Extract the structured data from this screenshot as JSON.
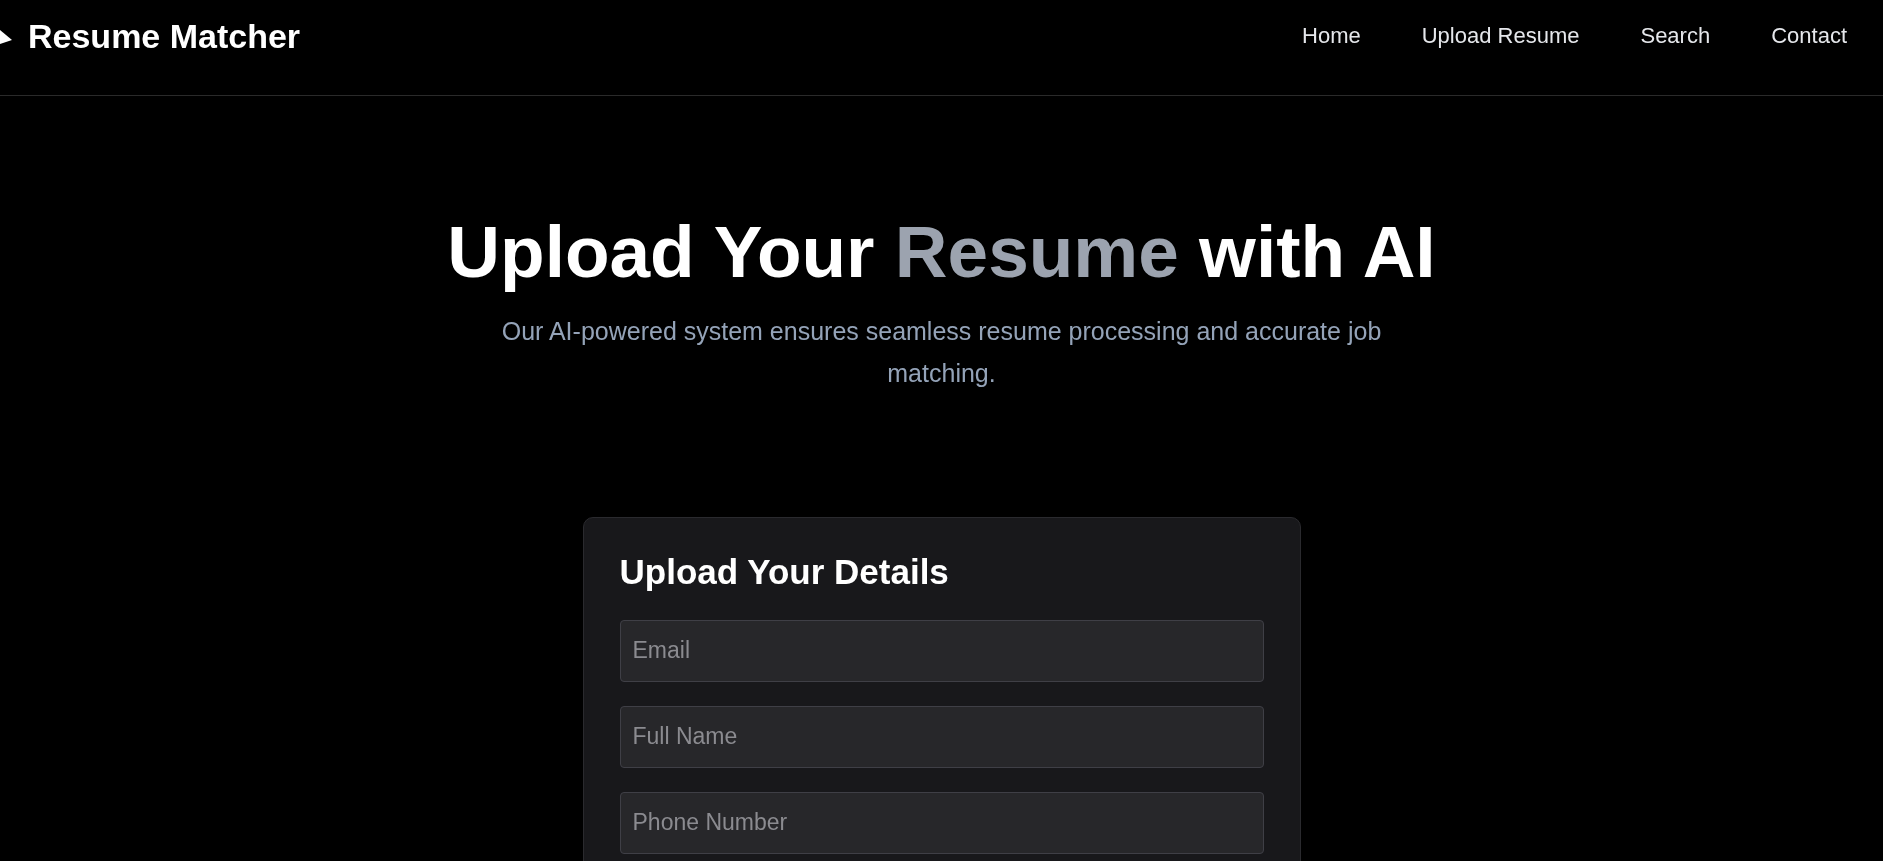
{
  "brand": {
    "name": "Resume Matcher"
  },
  "nav": [
    {
      "label": "Home"
    },
    {
      "label": "Upload Resume"
    },
    {
      "label": "Search"
    },
    {
      "label": "Contact"
    }
  ],
  "hero": {
    "title": [
      {
        "text": "Upload Your ",
        "highlight": false
      },
      {
        "text": "Resume",
        "highlight": true
      },
      {
        "text": " with AI",
        "highlight": false
      }
    ],
    "subtitle": "Our AI-powered system ensures seamless resume processing and accurate job matching."
  },
  "form": {
    "title": "Upload Your Details",
    "fields": [
      {
        "placeholder": "Email"
      },
      {
        "placeholder": "Full Name"
      },
      {
        "placeholder": "Phone Number"
      }
    ]
  }
}
